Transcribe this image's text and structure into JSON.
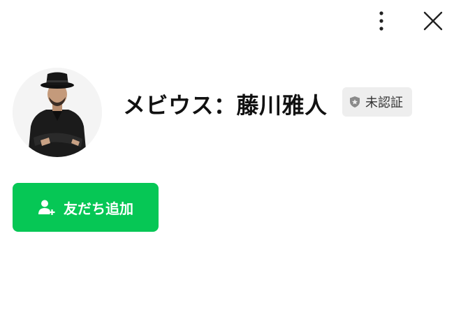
{
  "header": {
    "more_icon": "vertical-dots-icon",
    "close_icon": "close-icon"
  },
  "profile": {
    "name": "メビウス：藤川雅人",
    "avatar_icon": "profile-photo",
    "status_badge": {
      "icon": "shield-icon",
      "label": "未認証"
    }
  },
  "actions": {
    "add_friend_label": "友だち追加",
    "add_friend_icon": "add-person-icon"
  },
  "colors": {
    "primary": "#06c755",
    "badge_bg": "#eeeeee",
    "text": "#111111"
  }
}
